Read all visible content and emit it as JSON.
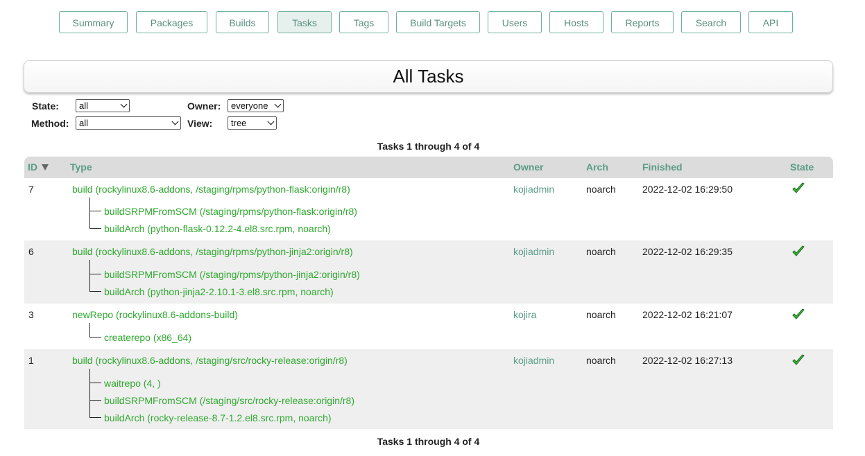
{
  "nav": {
    "items": [
      {
        "label": "Summary"
      },
      {
        "label": "Packages"
      },
      {
        "label": "Builds"
      },
      {
        "label": "Tasks",
        "active": true
      },
      {
        "label": "Tags"
      },
      {
        "label": "Build Targets"
      },
      {
        "label": "Users"
      },
      {
        "label": "Hosts"
      },
      {
        "label": "Reports"
      },
      {
        "label": "Search"
      },
      {
        "label": "API"
      }
    ]
  },
  "page_title": "All Tasks",
  "filters": {
    "state_label": "State",
    "state_value": "all",
    "owner_label": "Owner",
    "owner_value": "everyone",
    "method_label": "Method",
    "method_value": "all",
    "view_label": "View",
    "view_value": "tree"
  },
  "pager_text": "Tasks 1 through 4 of 4",
  "table": {
    "headers": {
      "id": "ID",
      "type": "Type",
      "owner": "Owner",
      "arch": "Arch",
      "finished": "Finished",
      "state": "State"
    },
    "rows": [
      {
        "id": "7",
        "type": "build (rockylinux8.6-addons, /staging/rpms/python-flask:origin/r8)",
        "owner": "kojiadmin",
        "arch": "noarch",
        "finished": "2022-12-02 16:29:50",
        "state": "closed",
        "children": [
          "buildSRPMFromSCM (/staging/rpms/python-flask:origin/r8)",
          "buildArch (python-flask-0.12.2-4.el8.src.rpm, noarch)"
        ]
      },
      {
        "id": "6",
        "type": "build (rockylinux8.6-addons, /staging/rpms/python-jinja2:origin/r8)",
        "owner": "kojiadmin",
        "arch": "noarch",
        "finished": "2022-12-02 16:29:35",
        "state": "closed",
        "children": [
          "buildSRPMFromSCM (/staging/rpms/python-jinja2:origin/r8)",
          "buildArch (python-jinja2-2.10.1-3.el8.src.rpm, noarch)"
        ]
      },
      {
        "id": "3",
        "type": "newRepo (rockylinux8.6-addons-build)",
        "owner": "kojira",
        "arch": "noarch",
        "finished": "2022-12-02 16:21:07",
        "state": "closed",
        "children": [
          "createrepo (x86_64)"
        ]
      },
      {
        "id": "1",
        "type": "build (rockylinux8.6-addons, /staging/src/rocky-release:origin/r8)",
        "owner": "kojiadmin",
        "arch": "noarch",
        "finished": "2022-12-02 16:27:13",
        "state": "closed",
        "children": [
          "waitrepo (4, )",
          "buildSRPMFromSCM (/staging/src/rocky-release:origin/r8)",
          "buildArch (rocky-release-8.7-1.2.el8.src.rpm, noarch)"
        ]
      }
    ]
  },
  "colors": {
    "link_green": "#2fa82f",
    "header_teal": "#5a9c88",
    "nav_border": "#6fb09c",
    "check_green": "#3cb83c"
  }
}
